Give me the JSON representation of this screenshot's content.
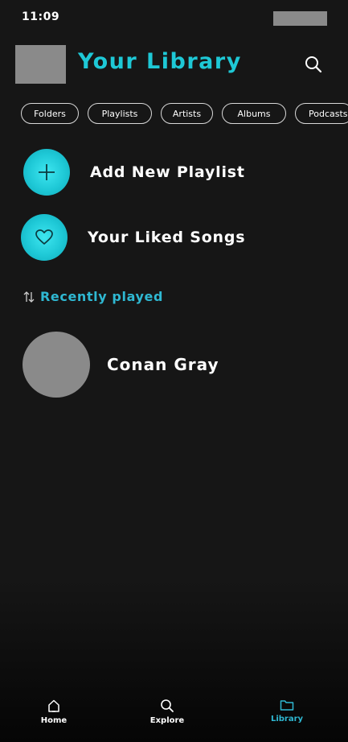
{
  "status_bar": {
    "time": "11:09"
  },
  "header": {
    "title": "Your Library",
    "search_icon": "search-icon"
  },
  "filters": [
    {
      "label": "Folders"
    },
    {
      "label": "Playlists"
    },
    {
      "label": "Artists"
    },
    {
      "label": "Albums"
    },
    {
      "label": "Podcasts"
    }
  ],
  "actions": {
    "add_playlist": {
      "label": "Add New Playlist",
      "icon": "plus-icon"
    },
    "liked_songs": {
      "label": "Your Liked Songs",
      "icon": "heart-icon"
    }
  },
  "recent": {
    "label": "Recently played",
    "sort_icon": "sort-arrows-icon",
    "items": [
      {
        "name": "Conan Gray"
      }
    ]
  },
  "bottom_nav": {
    "items": [
      {
        "label": "Home",
        "icon": "home-icon"
      },
      {
        "label": "Explore",
        "icon": "search-icon"
      },
      {
        "label": "Library",
        "icon": "folder-icon",
        "active": true
      }
    ]
  },
  "colors": {
    "accent": "#1ec8d6",
    "accent_text": "#2fb8d2",
    "background": "#161616",
    "placeholder": "#8a8a8a"
  }
}
